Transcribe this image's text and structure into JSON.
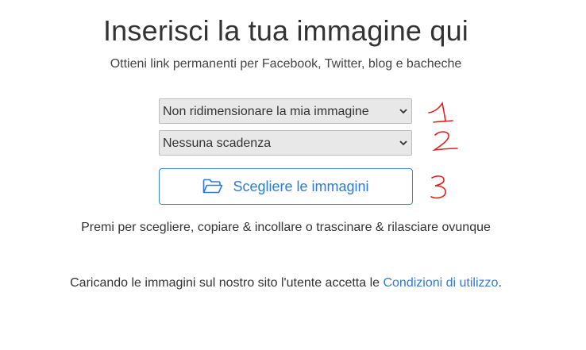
{
  "header": {
    "title": "Inserisci la tua immagine qui",
    "subtitle": "Ottieni link permanenti per Facebook, Twitter, blog e bacheche"
  },
  "resize_select": {
    "selected": "Non ridimensionare la mia immagine"
  },
  "expiry_select": {
    "selected": "Nessuna scadenza"
  },
  "upload": {
    "label": "Scegliere le immagini",
    "icon": "folder-open-icon"
  },
  "hint": "Premi per scegliere, copiare & incollare o trascinare & rilasciare ovunque",
  "terms": {
    "prefix": "Caricando le immagini sul nostro sito l'utente accetta le ",
    "link": "Condizioni di utilizzo",
    "suffix": "."
  },
  "annotations": [
    "1",
    "2",
    "3"
  ],
  "colors": {
    "accent": "#2f7bd1",
    "annotation": "#e0201e",
    "select_bg": "#e8e8e8"
  }
}
